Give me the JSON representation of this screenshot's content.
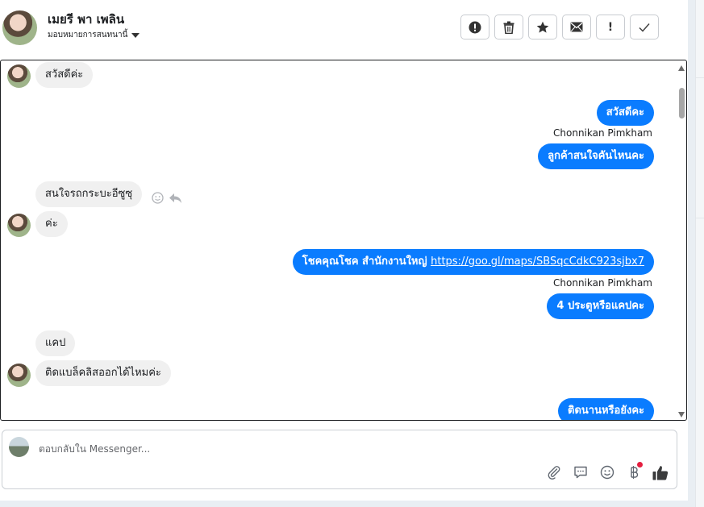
{
  "header": {
    "contact_name": "เมยรี พา เพลิน",
    "assign_label": "มอบหมายการสนทนานี้"
  },
  "toolbar": {
    "buttons": [
      {
        "icon": "alert-circle-icon"
      },
      {
        "icon": "trash-icon"
      },
      {
        "icon": "star-icon"
      },
      {
        "icon": "envelope-icon"
      },
      {
        "icon": "exclamation-icon",
        "label": "!"
      },
      {
        "icon": "check-icon"
      }
    ]
  },
  "messages": [
    {
      "direction": "in",
      "text": "สวัสดีค่ะ"
    },
    {
      "direction": "out",
      "text": "สวัสดีคะ"
    },
    {
      "direction": "out",
      "sender": "Chonnikan Pimkham",
      "text": "ลูกค้าสนใจคันไหนคะ"
    },
    {
      "direction": "in",
      "text": "สนใจรถกระบะอีซูซุ"
    },
    {
      "direction": "in",
      "text": "ค่ะ"
    },
    {
      "direction": "out",
      "text": "โชคคุณโชค สำนักงานใหญ่",
      "link": "https://goo.gl/maps/SBSqcCdkC923sjbx7"
    },
    {
      "direction": "out",
      "sender": "Chonnikan Pimkham",
      "text": "4 ประตูหรือแคปคะ"
    },
    {
      "direction": "in",
      "text": "แคป"
    },
    {
      "direction": "in",
      "text": "ติดแบล็คลิสออกได้ไหมค่ะ"
    },
    {
      "direction": "out",
      "text": "ติดนานหรือยังคะ"
    }
  ],
  "composer": {
    "placeholder": "ตอบกลับใน Messenger..."
  },
  "colors": {
    "outgoing_bubble": "#0a7cff",
    "incoming_bubble": "#f0f0f0",
    "notification_dot": "#e41e3f"
  }
}
